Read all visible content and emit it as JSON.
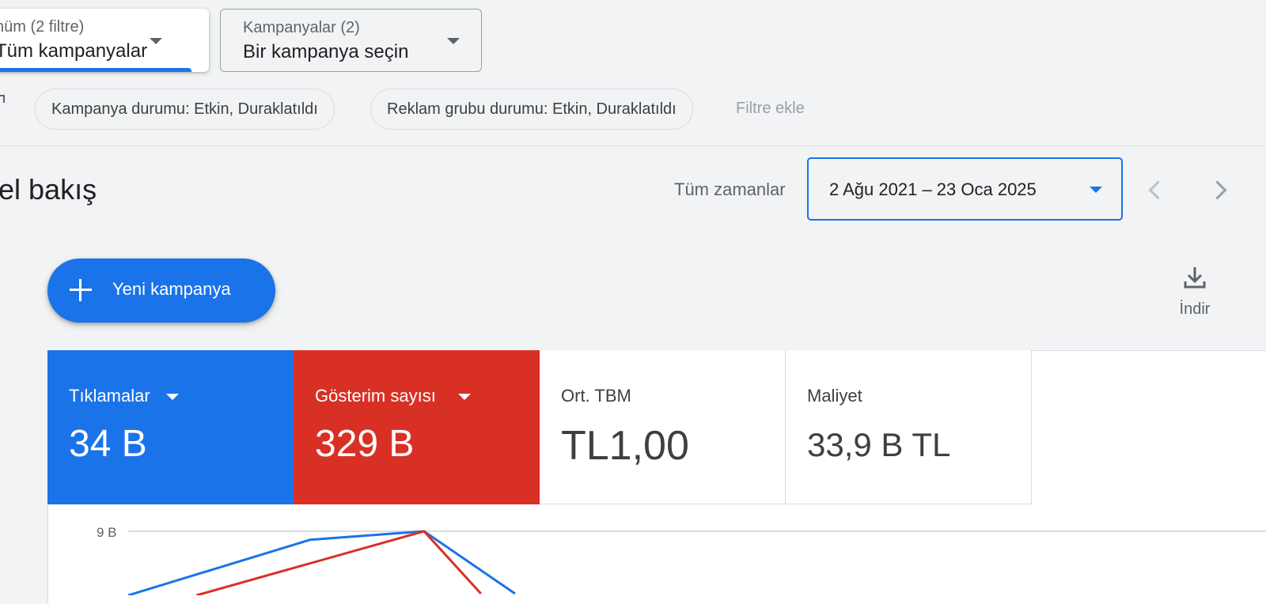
{
  "view_selector": {
    "sub": "nüm (2 filtre)",
    "main": "Tüm kampanyalar"
  },
  "campaign_selector": {
    "sub": "Kampanyalar (2)",
    "main": "Bir kampanya seçin"
  },
  "filters": {
    "chips": [
      "Kampanya durumu: Etkin, Duraklatıldı",
      "Reklam grubu durumu: Etkin, Duraklatıldı"
    ],
    "add_label": "Filtre ekle"
  },
  "page_title": "el bakış",
  "date": {
    "label": "Tüm zamanlar",
    "range": "2 Ağu 2021 – 23 Oca 2025"
  },
  "new_campaign_label": "Yeni kampanya",
  "download_label": "İndir",
  "metrics": [
    {
      "label": "Tıklamalar",
      "value": "34 B",
      "color": "#1a73e8"
    },
    {
      "label": "Gösterim sayısı",
      "value": "329 B",
      "color": "#d93025"
    },
    {
      "label": "Ort. TBM",
      "value": "TL1,00"
    },
    {
      "label": "Maliyet",
      "value": "33,9 B TL"
    }
  ],
  "chart_data": {
    "type": "line",
    "y_tick_labels": [
      "9 B"
    ],
    "series": [
      {
        "color": "#1a73e8",
        "points": [
          [
            0.0,
            5.2
          ],
          [
            0.16,
            8.5
          ],
          [
            0.26,
            9.0
          ],
          [
            0.34,
            5.3
          ]
        ]
      },
      {
        "color": "#d93025",
        "points": [
          [
            0.06,
            5.2
          ],
          [
            0.26,
            9.0
          ],
          [
            0.31,
            5.3
          ]
        ]
      }
    ],
    "ylim_visible": [
      5.2,
      9.3
    ]
  }
}
